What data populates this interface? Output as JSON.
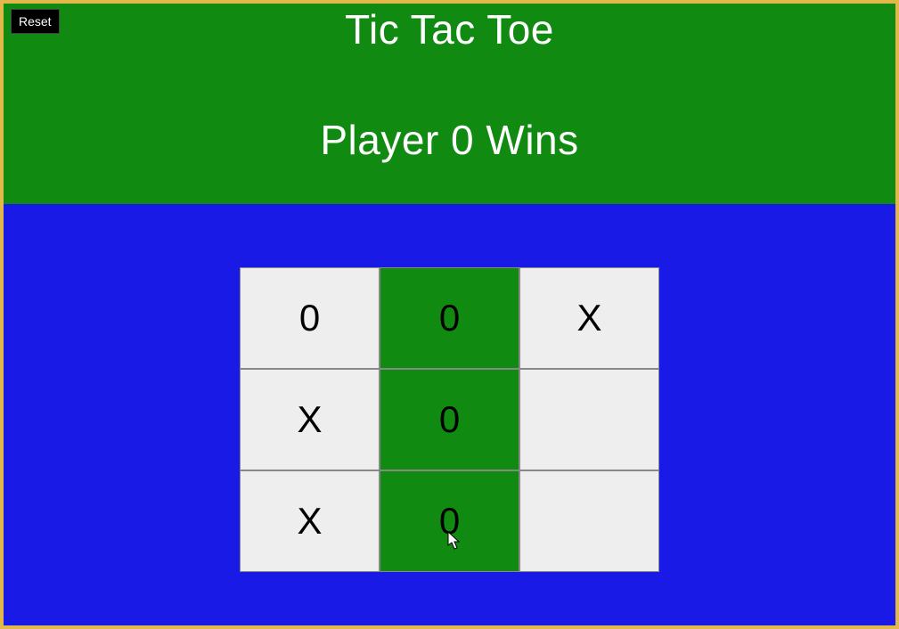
{
  "title": "Tic Tac Toe",
  "status": "Player 0 Wins",
  "reset_label": "Reset",
  "board": {
    "cells": [
      {
        "value": "0",
        "win": false
      },
      {
        "value": "0",
        "win": true
      },
      {
        "value": "X",
        "win": false
      },
      {
        "value": "X",
        "win": false
      },
      {
        "value": "0",
        "win": true
      },
      {
        "value": "",
        "win": false
      },
      {
        "value": "X",
        "win": false
      },
      {
        "value": "0",
        "win": true
      },
      {
        "value": "",
        "win": false
      }
    ]
  },
  "colors": {
    "header_bg": "#108a10",
    "board_bg": "#1a1ae6",
    "cell_bg": "#eeeeee",
    "win_bg": "#108a10",
    "frame_border": "#e2b84a"
  }
}
